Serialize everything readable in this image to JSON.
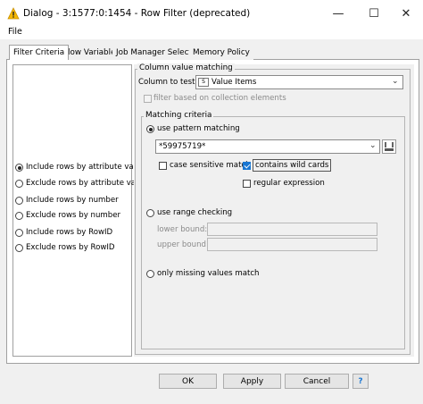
{
  "window": {
    "title": "Dialog - 3:1577:0:1454 - Row Filter (deprecated)",
    "controls": {
      "minimize": "—",
      "maximize": "☐",
      "close": "✕"
    }
  },
  "menu": {
    "file": "File"
  },
  "tabs": [
    {
      "label": "Filter Criteria",
      "active": true
    },
    {
      "label": "Flow Variables"
    },
    {
      "label": "Job Manager Selection"
    },
    {
      "label": "Memory Policy"
    }
  ],
  "left_options": [
    {
      "label": "Include rows by attribute value",
      "selected": true
    },
    {
      "label": "Exclude rows by attribute value"
    },
    {
      "label": "Include rows by number"
    },
    {
      "label": "Exclude rows by number"
    },
    {
      "label": "Include rows by RowID"
    },
    {
      "label": "Exclude rows by RowID"
    }
  ],
  "column_matching": {
    "group_label": "Column value matching",
    "column_label": "Column to test:",
    "column_type_badge": "S",
    "column_value": "Value Items",
    "collection_label": "filter based on collection elements"
  },
  "criteria": {
    "group_label": "Matching criteria",
    "pattern_radio": "use pattern matching",
    "pattern_value": "*59975719*",
    "case_sensitive": "case sensitive match",
    "wild_cards": "contains wild cards",
    "regex": "regular expression",
    "range_radio": "use range checking",
    "lower_bound": "lower bound:",
    "upper_bound": "upper bound:",
    "missing_radio": "only missing values match"
  },
  "buttons": {
    "ok": "OK",
    "apply": "Apply",
    "cancel": "Cancel",
    "help": "?"
  },
  "colors": {
    "accent": "#1976d2",
    "warning": "#f5b800"
  }
}
